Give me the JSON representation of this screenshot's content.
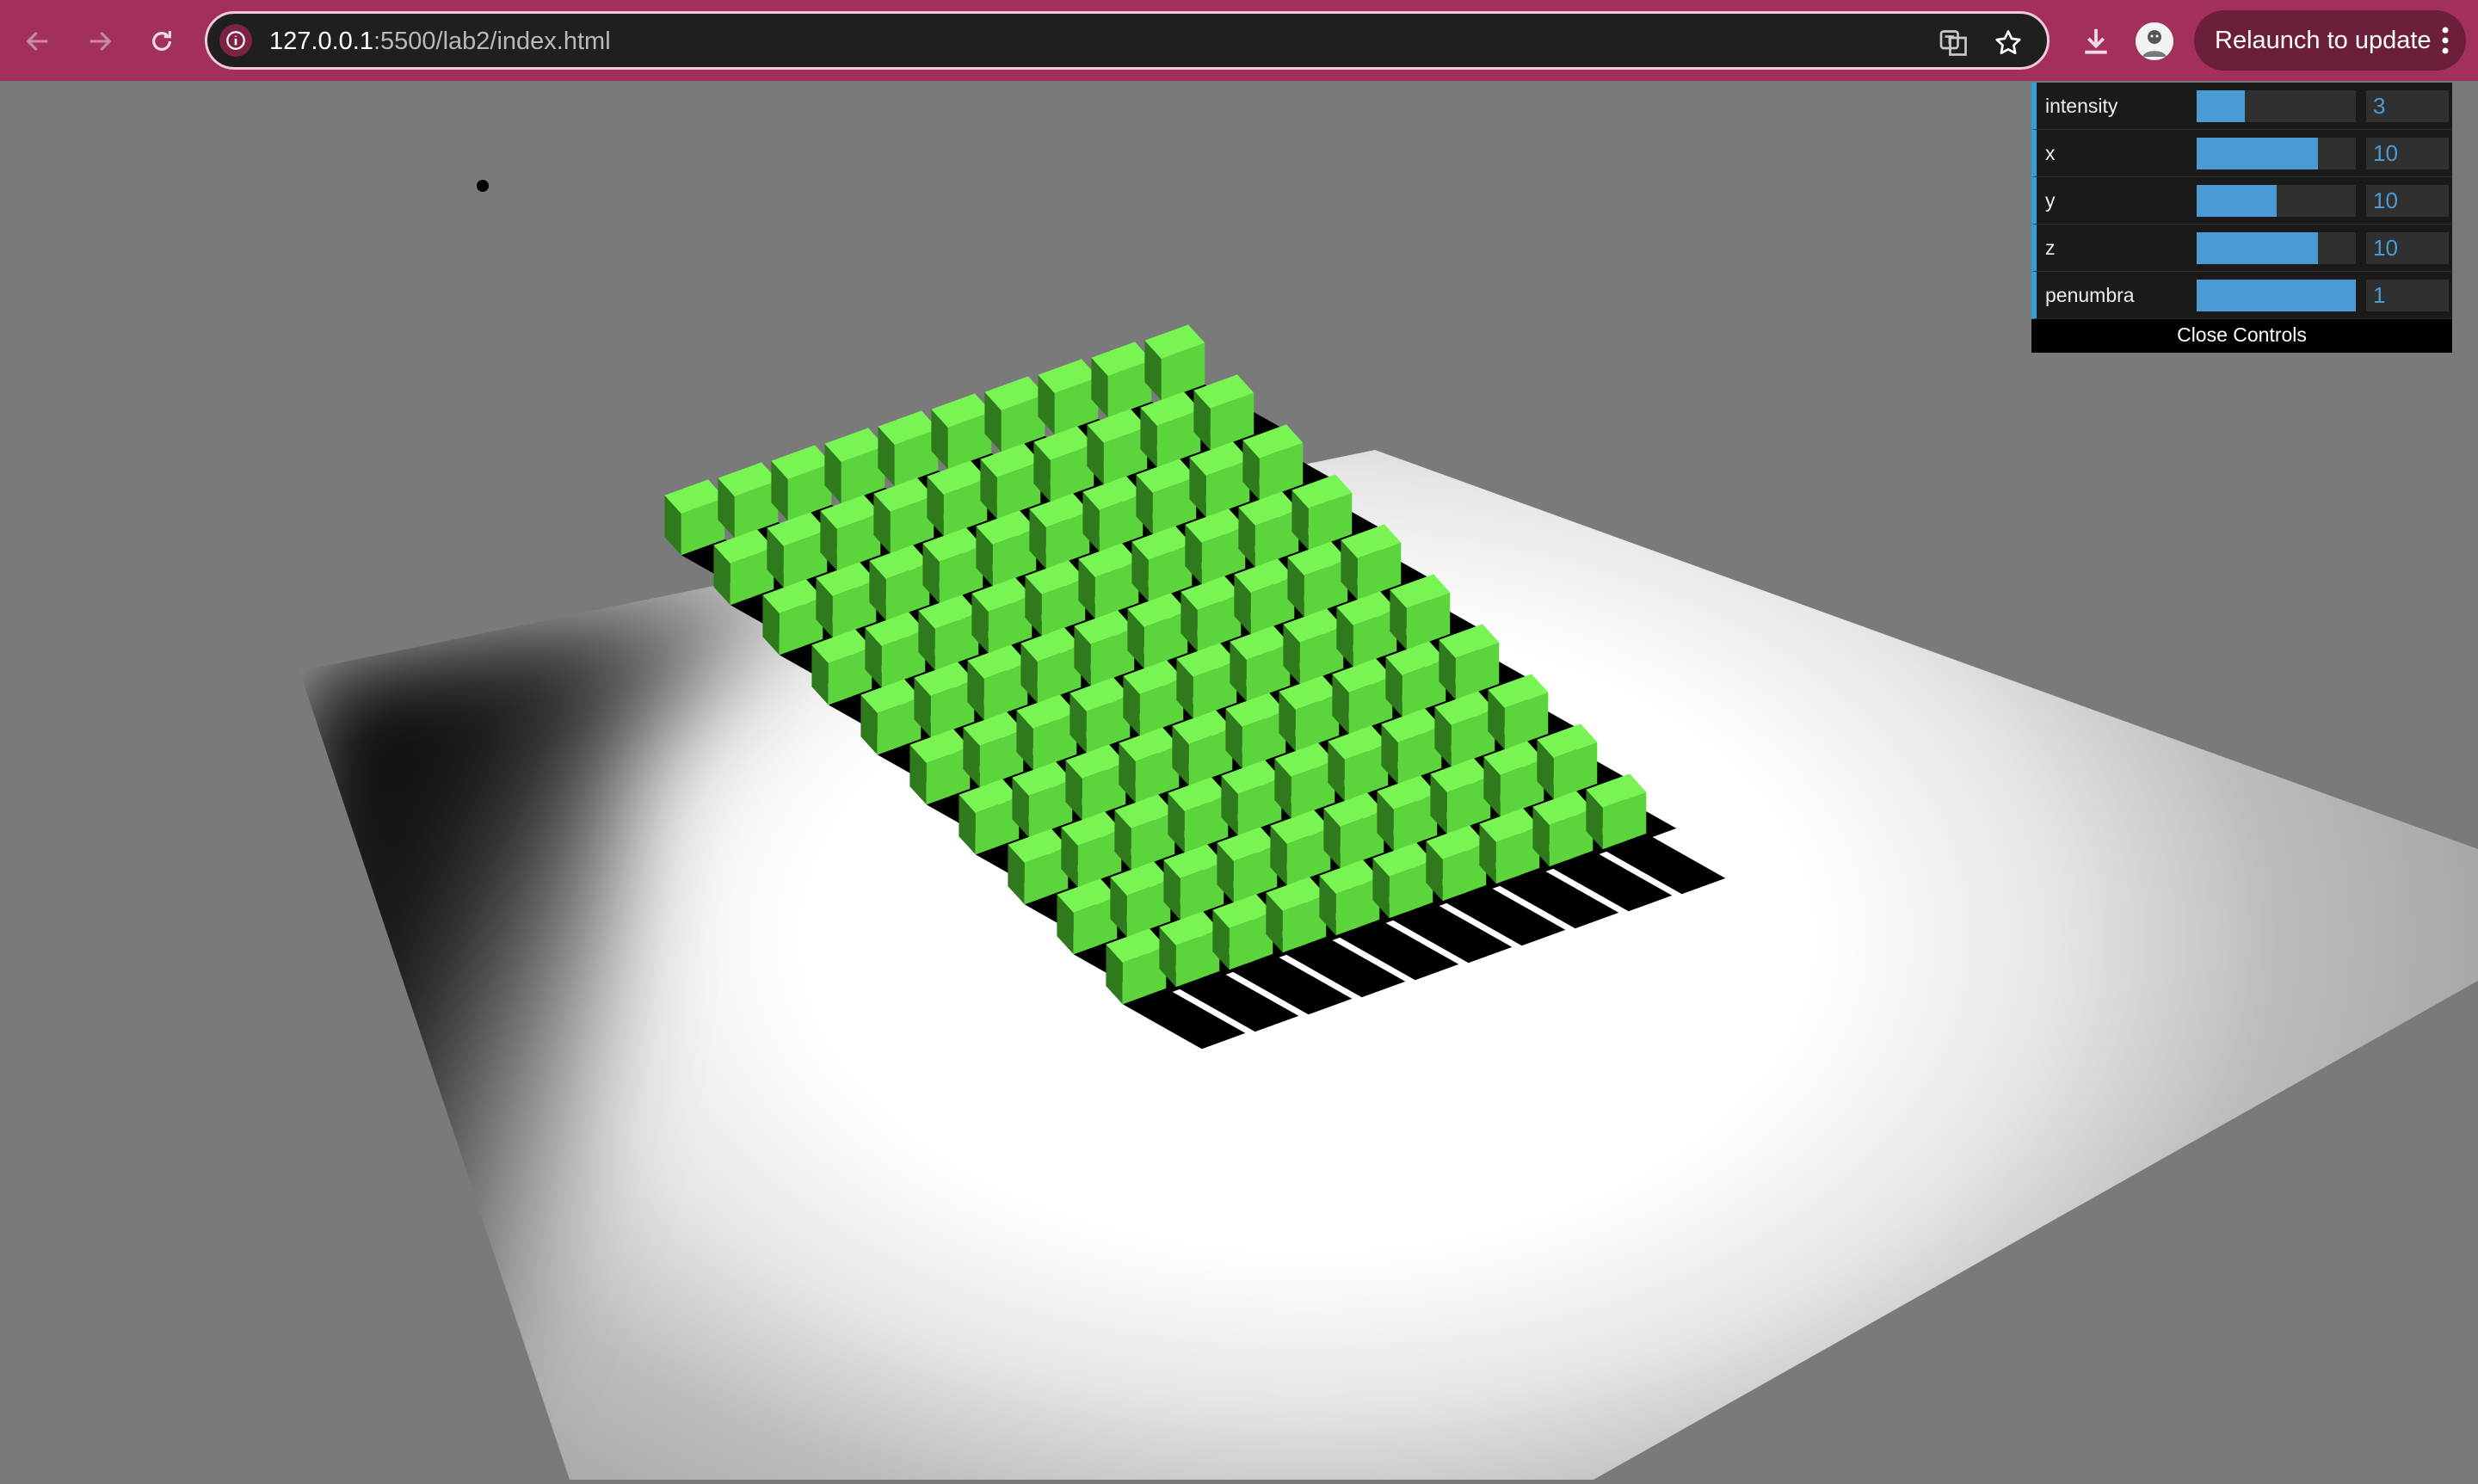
{
  "browser": {
    "url_host": "127.0.0.1",
    "url_rest": ":5500/lab2/index.html",
    "relaunch_label": "Relaunch to update",
    "icons": [
      "back-arrow-icon",
      "forward-arrow-icon",
      "reload-icon",
      "site-info-icon",
      "translate-icon",
      "bookmark-star-icon",
      "download-icon",
      "profile-avatar",
      "more-menu-icon"
    ]
  },
  "controls": {
    "rows": [
      {
        "label": "intensity",
        "value": "3",
        "fraction": 0.3
      },
      {
        "label": "x",
        "value": "10",
        "fraction": 0.76
      },
      {
        "label": "y",
        "value": "10",
        "fraction": 0.5
      },
      {
        "label": "z",
        "value": "10",
        "fraction": 0.76
      },
      {
        "label": "penumbra",
        "value": "1",
        "fraction": 1.0
      }
    ],
    "close_label": "Close Controls"
  },
  "scene": {
    "grid_rows": 10,
    "grid_cols": 10,
    "colors": {
      "background": "#7a7a7a",
      "plane_lit": "#ffffff",
      "plane_edge": "#a8a8a8",
      "cube_top": "#78f552",
      "cube_front": "#5cd43c",
      "cube_side": "#2f7a1c",
      "shadow": "#000000"
    }
  }
}
